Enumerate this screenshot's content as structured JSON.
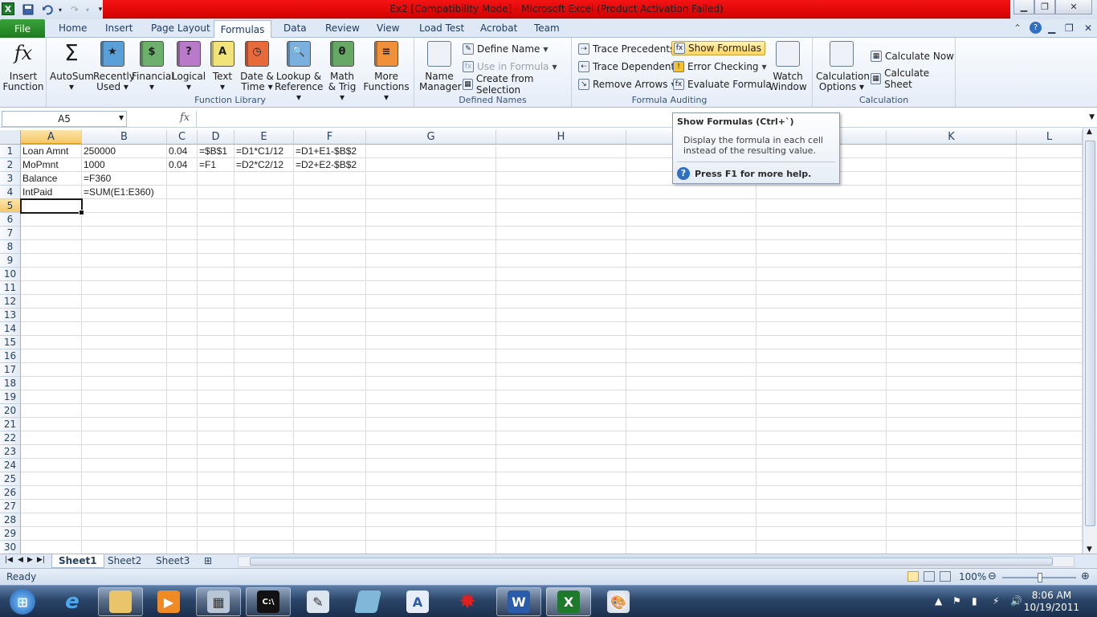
{
  "window": {
    "title": "Ex2  [Compatibility Mode]  -  Microsoft Excel (Product Activation Failed)"
  },
  "ribbon_tabs": [
    "File",
    "Home",
    "Insert",
    "Page Layout",
    "Formulas",
    "Data",
    "Review",
    "View",
    "Load Test",
    "Acrobat",
    "Team"
  ],
  "active_tab": "Formulas",
  "function_library": {
    "label": "Function Library",
    "buttons": [
      {
        "line1": "Insert",
        "line2": "Function"
      },
      {
        "line1": "AutoSum",
        "line2": "▾"
      },
      {
        "line1": "Recently",
        "line2": "Used ▾"
      },
      {
        "line1": "Financial",
        "line2": "▾"
      },
      {
        "line1": "Logical",
        "line2": "▾"
      },
      {
        "line1": "Text",
        "line2": "▾"
      },
      {
        "line1": "Date &",
        "line2": "Time ▾"
      },
      {
        "line1": "Lookup &",
        "line2": "Reference ▾"
      },
      {
        "line1": "Math",
        "line2": "& Trig ▾"
      },
      {
        "line1": "More",
        "line2": "Functions ▾"
      }
    ]
  },
  "defined_names": {
    "label": "Defined Names",
    "name_manager": {
      "line1": "Name",
      "line2": "Manager"
    },
    "define_name": "Define Name",
    "use_in_formula": "Use in Formula",
    "create_from_selection": "Create from Selection"
  },
  "formula_auditing": {
    "label": "Formula Auditing",
    "trace_precedents": "Trace Precedents",
    "trace_dependents": "Trace Dependents",
    "remove_arrows": "Remove Arrows",
    "show_formulas": "Show Formulas",
    "error_checking": "Error Checking",
    "evaluate_formula": "Evaluate Formula",
    "watch_window": {
      "line1": "Watch",
      "line2": "Window"
    }
  },
  "calculation": {
    "label": "Calculation",
    "options": {
      "line1": "Calculation",
      "line2": "Options ▾"
    },
    "calculate_now": "Calculate Now",
    "calculate_sheet": "Calculate Sheet"
  },
  "formula_bar": {
    "name_box": "A5",
    "fx": "fx",
    "content": ""
  },
  "columns": [
    "A",
    "B",
    "C",
    "D",
    "E",
    "F",
    "G",
    "H",
    "I",
    "J",
    "K",
    "L"
  ],
  "rows": [
    "1",
    "2",
    "3",
    "4",
    "5",
    "6",
    "7",
    "8",
    "9",
    "10",
    "11",
    "12",
    "13",
    "14",
    "15",
    "16",
    "17",
    "18",
    "19",
    "20",
    "21",
    "22",
    "23",
    "24",
    "25",
    "26",
    "27",
    "28",
    "29",
    "30"
  ],
  "cells": {
    "A1": "Loan Amnt",
    "B1": "250000",
    "C1": "0.04",
    "D1": "=$B$1",
    "E1": "=D1*C1/12",
    "F1": "=D1+E1-$B$2",
    "A2": "MoPmnt",
    "B2": "1000",
    "C2": "0.04",
    "D2": "=F1",
    "E2": "=D2*C2/12",
    "F2": "=D2+E2-$B$2",
    "A3": "Balance",
    "B3": "=F360",
    "A4": "IntPaid",
    "B4": "=SUM(E1:E360)"
  },
  "tooltip": {
    "title": "Show Formulas (Ctrl+`)",
    "body": "Display the formula in each cell instead of the resulting value.",
    "help": "Press F1 for more help."
  },
  "sheets": [
    "Sheet1",
    "Sheet2",
    "Sheet3"
  ],
  "active_sheet": "Sheet1",
  "status": {
    "ready": "Ready",
    "zoom": "100%"
  },
  "clock": {
    "time": "8:06 AM",
    "date": "10/19/2011"
  }
}
